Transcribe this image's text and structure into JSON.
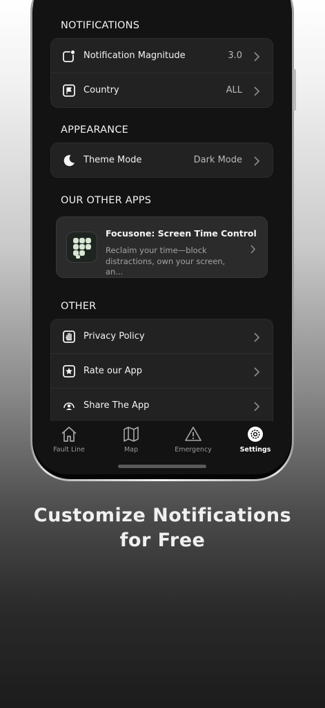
{
  "sections": {
    "notifications": {
      "title": "NOTIFICATIONS",
      "rows": [
        {
          "label": "Notification Magnitude",
          "value": "3.0",
          "icon": "notification-badge-icon"
        },
        {
          "label": "Country",
          "value": "ALL",
          "icon": "flag-icon"
        }
      ]
    },
    "appearance": {
      "title": "APPEARANCE",
      "rows": [
        {
          "label": "Theme Mode",
          "value": "Dark Mode",
          "icon": "moon-icon"
        }
      ]
    },
    "other_apps": {
      "title": "OUR OTHER APPS",
      "app": {
        "name": "Focusone: Screen Time Control",
        "description": "Reclaim your time—block distractions, own your screen, an...",
        "icon": "focusone-app-icon"
      }
    },
    "other": {
      "title": "OTHER",
      "rows": [
        {
          "label": "Privacy Policy",
          "icon": "hand-icon"
        },
        {
          "label": "Rate our App",
          "icon": "star-icon"
        },
        {
          "label": "Share The App",
          "icon": "share-person-icon"
        }
      ]
    }
  },
  "tabbar": {
    "tabs": [
      {
        "label": "Fault Line",
        "icon": "home-icon",
        "active": false
      },
      {
        "label": "Map",
        "icon": "map-icon",
        "active": false
      },
      {
        "label": "Emergency",
        "icon": "warning-icon",
        "active": false
      },
      {
        "label": "Settings",
        "icon": "gear-icon",
        "active": true
      }
    ]
  },
  "caption": {
    "line1": "Customize Notifications",
    "line2": "for Free"
  },
  "colors": {
    "screen_bg": "#131313",
    "card_bg": "#222222",
    "text_primary": "#f3f3f3",
    "text_secondary": "#b9b9b9"
  }
}
